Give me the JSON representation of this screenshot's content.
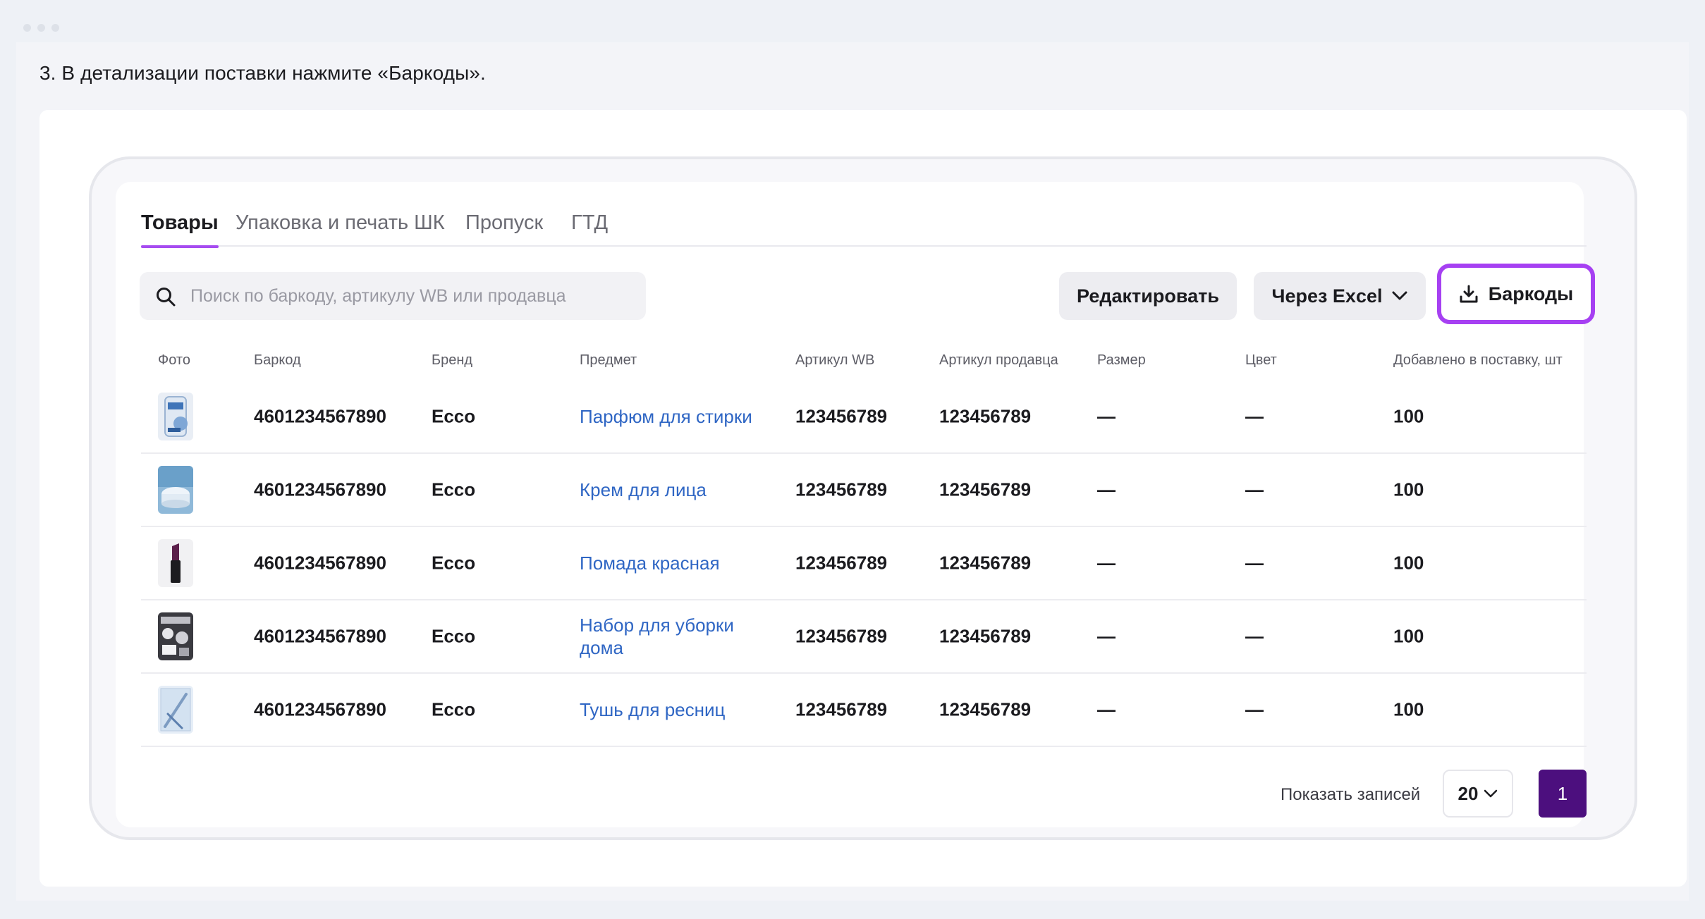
{
  "step_text": "3. В детализации поставки нажмите «Баркоды».",
  "tabs": [
    {
      "label": "Товары",
      "active": true
    },
    {
      "label": "Упаковка и печать ШК",
      "active": false
    },
    {
      "label": "Пропуск",
      "active": false
    },
    {
      "label": "ГТД",
      "active": false
    }
  ],
  "search": {
    "placeholder": "Поиск по баркоду, артикулу WB или продавца",
    "value": ""
  },
  "toolbar": {
    "edit_label": "Редактировать",
    "excel_label": "Через Excel",
    "barcodes_label": "Баркоды"
  },
  "table": {
    "headers": {
      "photo": "Фото",
      "barcode": "Баркод",
      "brand": "Бренд",
      "subject": "Предмет",
      "article_wb": "Артикул WB",
      "article_seller": "Артикул продавца",
      "size": "Размер",
      "color": "Цвет",
      "added": "Добавлено в поставку, шт"
    },
    "rows": [
      {
        "barcode": "4601234567890",
        "brand": "Ecco",
        "subject": "Парфюм для стирки",
        "article_wb": "123456789",
        "article_seller": "123456789",
        "size": "—",
        "color": "—",
        "added": "100",
        "thumb": "laundry-perfume-thumb"
      },
      {
        "barcode": "4601234567890",
        "brand": "Ecco",
        "subject": "Крем для лица",
        "article_wb": "123456789",
        "article_seller": "123456789",
        "size": "—",
        "color": "—",
        "added": "100",
        "thumb": "face-cream-thumb"
      },
      {
        "barcode": "4601234567890",
        "brand": "Ecco",
        "subject": "Помада красная",
        "article_wb": "123456789",
        "article_seller": "123456789",
        "size": "—",
        "color": "—",
        "added": "100",
        "thumb": "lipstick-thumb"
      },
      {
        "barcode": "4601234567890",
        "brand": "Ecco",
        "subject": "Набор для уборки дома",
        "article_wb": "123456789",
        "article_seller": "123456789",
        "size": "—",
        "color": "—",
        "added": "100",
        "thumb": "cleaning-set-thumb"
      },
      {
        "barcode": "4601234567890",
        "brand": "Ecco",
        "subject": "Тушь для ресниц",
        "article_wb": "123456789",
        "article_seller": "123456789",
        "size": "—",
        "color": "—",
        "added": "100",
        "thumb": "mascara-thumb"
      }
    ]
  },
  "pagination": {
    "show_label": "Показать записей",
    "per_page": "20",
    "current_page": "1"
  },
  "colors": {
    "accent_purple": "#a640f2",
    "page_button": "#4c0f7e",
    "link_blue": "#2f66c4"
  }
}
